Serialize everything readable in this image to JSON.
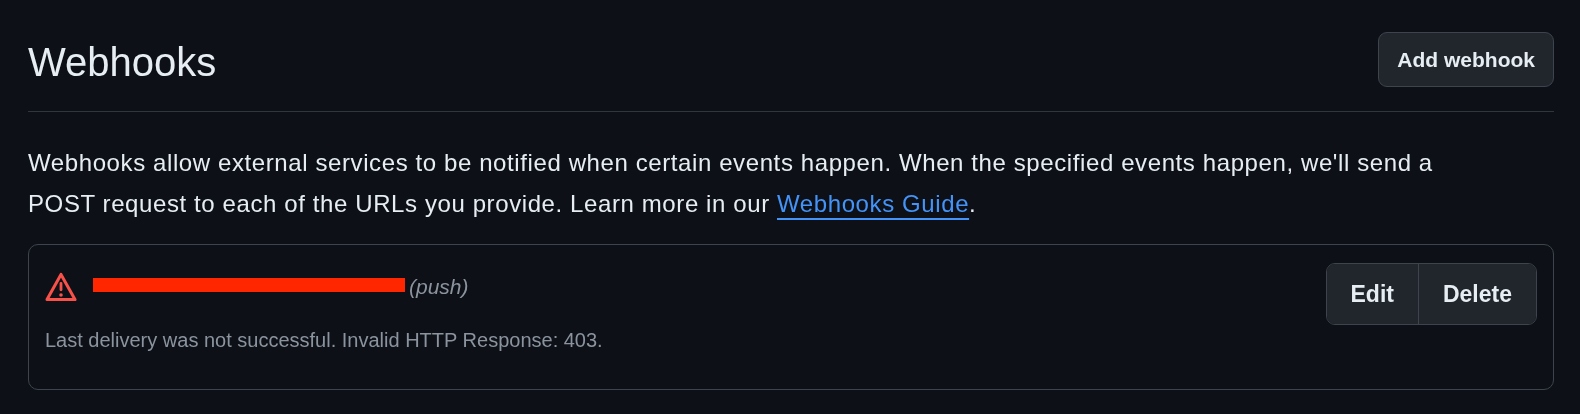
{
  "header": {
    "title": "Webhooks",
    "add_button": "Add webhook"
  },
  "intro": {
    "text": "Webhooks allow external services to be notified when certain events happen. When the specified events happen, we'll send a POST request to each of the URLs you provide. Learn more in our ",
    "link": "Webhooks Guide",
    "after": "."
  },
  "hooks": [
    {
      "kind": "warning",
      "url_redacted": true,
      "events": "(push)",
      "message": "Last delivery was not successful. Invalid HTTP Response: 403.",
      "actions": [
        "Edit",
        "Delete"
      ]
    }
  ]
}
